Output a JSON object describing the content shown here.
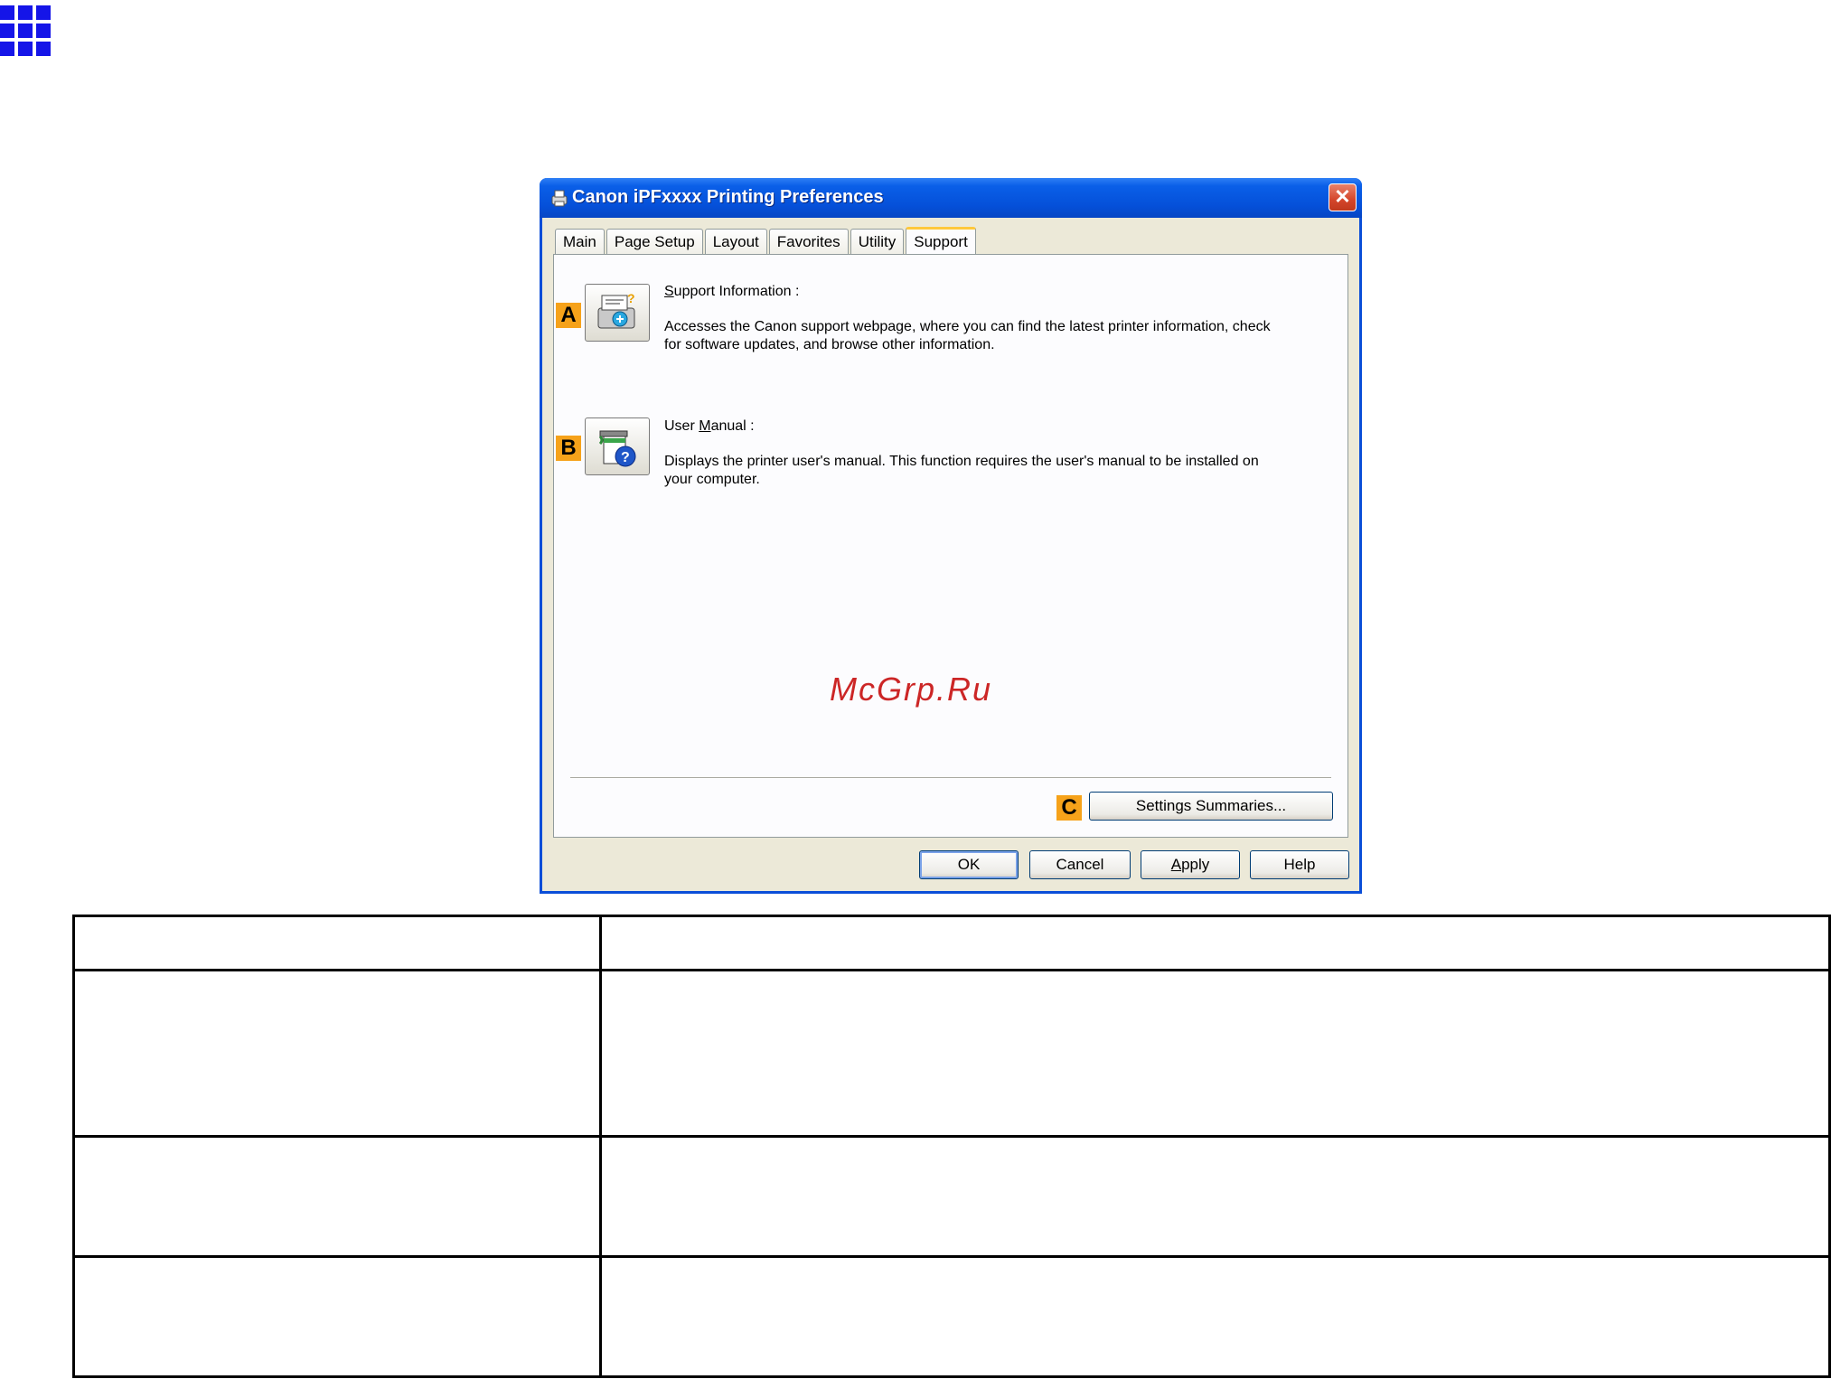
{
  "dialog": {
    "title": "Canon iPFxxxx Printing Preferences",
    "close_glyph": "✕"
  },
  "tabs": [
    {
      "label": "Main"
    },
    {
      "label": "Page Setup"
    },
    {
      "label": "Layout"
    },
    {
      "label": "Favorites"
    },
    {
      "label": "Utility"
    },
    {
      "label": "Support"
    }
  ],
  "support_info": {
    "marker": "A",
    "title_first": "S",
    "title_rest": "upport Information :",
    "description_line1": "Accesses the Canon support webpage, where you can find the latest printer information, check",
    "description_line2": "for software updates, and browse other information.",
    "icon": "support-info-icon"
  },
  "user_manual": {
    "marker": "B",
    "title_pre": "User ",
    "title_ul": "M",
    "title_post": "anual :",
    "description_line1": "Displays the printer user's manual. This function requires the user's manual to be installed on",
    "description_line2": "your computer.",
    "icon": "user-manual-icon"
  },
  "settings": {
    "marker": "C",
    "button_label": "Settings Summaries..."
  },
  "buttons": {
    "ok": "OK",
    "cancel": "Cancel",
    "apply_ul": "A",
    "apply_rest": "pply",
    "help": "Help"
  },
  "watermark": "McGrp.Ru",
  "colors": {
    "titlebar": "#0550d9",
    "marker": "#f6a21a",
    "grid_icon": "#1515e8"
  }
}
